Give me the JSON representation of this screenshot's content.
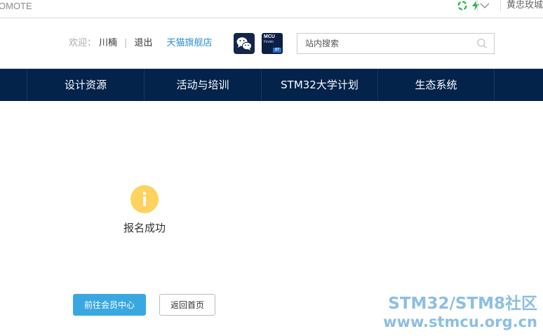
{
  "browser": {
    "tab_title": "OMOTE",
    "profile_name": "黄忠玫城",
    "colors": {
      "ext_green": "#2db24a"
    }
  },
  "header": {
    "welcome_label": "欢迎：",
    "username": "川楠",
    "separator": "|",
    "logout": "退出",
    "tmall_link": "天猫旗舰店",
    "mcu_finder": {
      "line1": "MCU",
      "line2": "Finder",
      "brand": "ST"
    },
    "search": {
      "placeholder": "站内搜索",
      "value": ""
    }
  },
  "nav": {
    "items": [
      {
        "label": "设计资源"
      },
      {
        "label": "活动与培训"
      },
      {
        "label": "STM32大学计划"
      },
      {
        "label": "生态系统"
      }
    ],
    "color": "#03234b"
  },
  "result": {
    "icon_color": "#fdd25e",
    "message": "报名成功"
  },
  "actions": {
    "primary_label": "前往会员中心",
    "secondary_label": "返回首页",
    "primary_color": "#3aa8e0"
  },
  "watermark": {
    "line1": "STM32/STM8社区",
    "line2": "www.stmcu.org.cn"
  }
}
